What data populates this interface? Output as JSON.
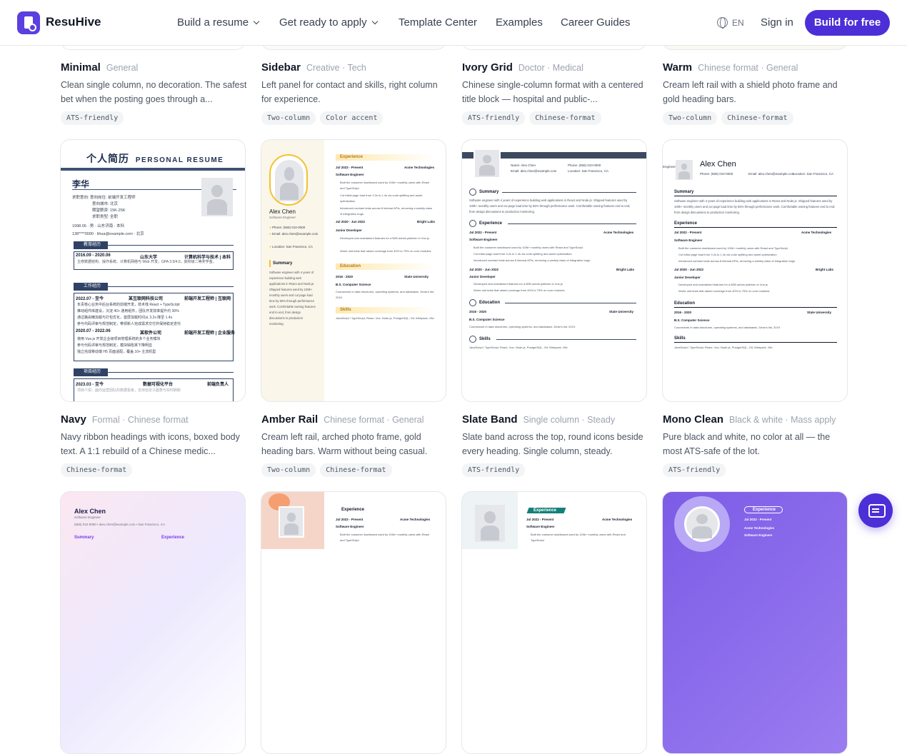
{
  "header": {
    "brand": "ResuHive",
    "nav": [
      {
        "label": "Build a resume",
        "dropdown": true
      },
      {
        "label": "Get ready to apply",
        "dropdown": true
      },
      {
        "label": "Template Center",
        "dropdown": false
      },
      {
        "label": "Examples",
        "dropdown": false
      },
      {
        "label": "Career Guides",
        "dropdown": false
      }
    ],
    "language": "EN",
    "sign_in": "Sign in",
    "cta": "Build for free"
  },
  "colors": {
    "accent": "#4c2fd6",
    "tag_bg": "#f3f4f6",
    "muted": "#9ca3af"
  },
  "templates": [
    {
      "name": "Minimal",
      "category": "General",
      "description": "Clean single column, no decoration. The safest bet when the posting goes through a...",
      "tags": [
        "ATS-friendly"
      ]
    },
    {
      "name": "Sidebar",
      "category": "Creative · Tech",
      "description": "Left panel for contact and skills, right column for experience.",
      "tags": [
        "Two-column",
        "Color accent"
      ]
    },
    {
      "name": "Ivory Grid",
      "category": "Doctor · Medical",
      "description": "Chinese single-column format with a centered title block — hospital and public-...",
      "tags": [
        "ATS-friendly",
        "Chinese-format"
      ]
    },
    {
      "name": "Warm",
      "category": "Chinese format · General",
      "description": "Cream left rail with a shield photo frame and gold heading bars.",
      "tags": [
        "Two-column",
        "Chinese-format"
      ]
    },
    {
      "name": "Navy",
      "category": "Formal · Chinese format",
      "description": "Navy ribbon headings with icons, boxed body text. A 1:1 rebuild of a Chinese medic...",
      "tags": [
        "Chinese-format"
      ]
    },
    {
      "name": "Amber Rail",
      "category": "Chinese format · General",
      "description": "Cream left rail, arched photo frame, gold heading bars. Warm without being casual.",
      "tags": [
        "Two-column",
        "Chinese-format"
      ]
    },
    {
      "name": "Slate Band",
      "category": "Single column · Steady",
      "description": "Slate band across the top, round icons beside every heading. Single column, steady.",
      "tags": [
        "ATS-friendly"
      ]
    },
    {
      "name": "Mono Clean",
      "category": "Black & white · Mass apply",
      "description": "Pure black and white, no color at all — the most ATS-safe of the lot.",
      "tags": [
        "ATS-friendly"
      ]
    }
  ],
  "previews": {
    "navy": {
      "title_cn": "个人简历",
      "title_en": "PERSONAL RESUME",
      "name": "李华",
      "intent": "求职意向: 意向岗位: 前端开发工程师",
      "city": "意向城市: 北京",
      "salary": "期望薪资: 15K-25K",
      "type": "求职类型: 全职",
      "birth": "1998.06",
      "gender": "男",
      "place": "山东济南",
      "degree": "本科",
      "phone": "138****0000",
      "email": "lihua@example.com",
      "base": "北京",
      "sec_edu": "教育经历",
      "edu_date": "2016.09 - 2020.06",
      "edu_school": "山东大学",
      "edu_major": "计算机科学与技术 | 本科",
      "edu_line": "主修数据结构、操作系统、计算机网络与 Web 开发，GPA 3.5/4.0，获校级二等奖学金。",
      "sec_work": "工作经历",
      "w1_date": "2022.07 - 至今",
      "w1_co": "某互联网科技公司",
      "w1_role": "前端开发工程师 | 互联网",
      "w1_b1": "负责核心业务中后台系统的前端开发，技术栈 React + TypeScript",
      "w1_b2": "推动组件库建设，沉淀 40+ 通用组件，团队开发效率提升约 30%",
      "w1_b3": "通过路由懒加载与打包优化，首屏加载时间从 3.2s 降至 1.4s",
      "w1_b4": "参与代码评审与规范制定，带领新人完成需求交付并保持稳定迭代",
      "w2_date": "2020.07 - 2022.06",
      "w2_co": "某软件公司",
      "w2_role": "前端开发工程师 | 企业服务",
      "w2_b1": "使用 Vue.js 开发企业级项目管理系统的多个业务模块",
      "w2_b2": "参与代码评审与规范制定，模块缺陷率下降明显",
      "w2_b3": "独立完成移动端 H5 页面适配，覆盖 10+ 主流机型",
      "sec_proj": "项目经历",
      "p1_date": "2023.03 - 至今",
      "p1_name": "数据可视化平台",
      "p1_role": "前端负责人",
      "p1_b1": "项目介绍：面向运营团队的数据看板，支持自定义图表与实时刷新"
    },
    "amber": {
      "name": "Alex Chen",
      "role": "Software Engineer",
      "phone_label": "Phone:",
      "phone": "(555) 010-0000",
      "email_label": "Email:",
      "email": "alex.chen@example.com",
      "loc_label": "Location:",
      "loc": "San Francisco, CA",
      "summary_h": "Summary",
      "summary": "Software engineer with 4 years of experience building web applications in React and Node.js. Shipped features used by 100k+ monthly users and cut page load time by 55% through performance work. Comfortable owning features end to end, from design discussions to production monitoring.",
      "exp_h": "Experience",
      "j1_date": "Jul 2022 - Present",
      "j1_co": "Acme Technologies",
      "j1_role": "Software Engineer",
      "j1_b1": "Built the customer dashboard used by 100k+ monthly users with React and TypeScript",
      "j1_b2": "Cut initial page load from 3.2s to 1.4s via code splitting and asset optimization",
      "j1_b3": "Introduced contract tests across 8 internal APIs, removing a weekly class of integration bugs",
      "j2_date": "Jul 2020 - Jun 2022",
      "j2_co": "Bright Labs",
      "j2_role": "Junior Developer",
      "j2_b1": "Developed and maintained features for a B2B admin platform in Vue.js",
      "j2_b2": "Wrote unit tests that raised coverage from 40% to 75% on core modules",
      "edu_h": "Education",
      "e_date": "2016 - 2020",
      "e_school": "State University",
      "e_deg": "B.S. Computer Science",
      "e_line": "Coursework in data structures, operating systems, and databases. Dean's list, 2019.",
      "skills_h": "Skills",
      "skills": "JavaScript / TypeScript, React, Vue, Node.js, PostgreSQL, Git, Webpack, Vite"
    },
    "slate": {
      "name": "Name: Alex Chen",
      "phone": "Phone: (555) 010-0000",
      "email": "Email: alex.chen@example.com",
      "loc": "Location: San Francisco, CA",
      "summary_h": "Summary",
      "summary": "Software engineer with 4 years of experience building web applications in React and Node.js. Shipped features used by 100k+ monthly users and cut page load time by 55% through performance work. Comfortable owning features end to end, from design discussions to production monitoring.",
      "exp_h": "Experience",
      "j1_date": "Jul 2022 - Present",
      "j1_co": "Acme Technologies",
      "j1_role": "Software Engineer",
      "j1_b1": "Built the customer dashboard used by 100k+ monthly users with React and TypeScript",
      "j1_b2": "Cut initial page load from 3.2s to 1.4s via code splitting and asset optimization",
      "j1_b3": "Introduced contract tests across 8 internal APIs, removing a weekly class of integration bugs",
      "j2_date": "Jul 2020 - Jun 2022",
      "j2_co": "Bright Labs",
      "j2_role": "Junior Developer",
      "j2_b1": "Developed and maintained features for a B2B admin platform in Vue.js",
      "j2_b2": "Wrote unit tests that raised coverage from 40% to 75% on core modules",
      "edu_h": "Education",
      "e_date": "2016 - 2020",
      "e_school": "State University",
      "e_deg": "B.S. Computer Science",
      "e_line": "Coursework in data structures, operating systems, and databases. Dean's list, 2019.",
      "skills_h": "Skills",
      "skills": "JavaScript / TypeScript, React, Vue, Node.js, PostgreSQL, Git, Webpack, Vite"
    },
    "mono": {
      "cut": "Engineer",
      "name": "Alex Chen",
      "phone": "Phone: (555) 010-0000",
      "email": "Email: alex.chen@example.com",
      "loc": "Location: San Francisco, CA",
      "summary_h": "Summary",
      "summary": "Software engineer with 4 years of experience building web applications in React and Node.js. Shipped features used by 100k+ monthly users and cut page load time by 55% through performance work. Comfortable owning features end to end, from design discussions to production monitoring.",
      "exp_h": "Experience",
      "j1_date": "Jul 2022 - Present",
      "j1_co": "Acme Technologies",
      "j1_role": "Software Engineer",
      "j1_b1": "Built the customer dashboard used by 100k+ monthly users with React and TypeScript",
      "j1_b2": "Cut initial page load from 3.2s to 1.4s via code splitting and asset optimization",
      "j1_b3": "Introduced contract tests across 8 internal APIs, removing a weekly class of integration bugs",
      "j2_date": "Jul 2020 - Jun 2022",
      "j2_co": "Bright Labs",
      "j2_role": "Junior Developer",
      "j2_b1": "Developed and maintained features for a B2B admin platform in Vue.js",
      "j2_b2": "Wrote unit tests that raised coverage from 40% to 75% on core modules",
      "edu_h": "Education",
      "e_date": "2016 - 2020",
      "e_school": "State University",
      "e_deg": "B.S. Computer Science",
      "e_line": "Coursework in data structures, operating systems, and databases. Dean's list, 2019.",
      "skills_h": "Skills",
      "skills": "JavaScript / TypeScript, React, Vue, Node.js, PostgreSQL, Git, Webpack, Vite"
    },
    "row3": {
      "a_name": "Alex Chen",
      "a_role": "Software Engineer",
      "a_contact": "(555) 010-0000  •  alex.chen@example.com  •  San Francisco, CA",
      "a_sum": "Summary",
      "a_exp": "Experience",
      "exp": "Experience",
      "j_date": "Jul 2022 - Present",
      "j_co": "Acme Technologies",
      "j_role": "Software Engineer",
      "j_b1": "Built the customer dashboard used by 100k+ monthly users with React and TypeScript"
    }
  }
}
